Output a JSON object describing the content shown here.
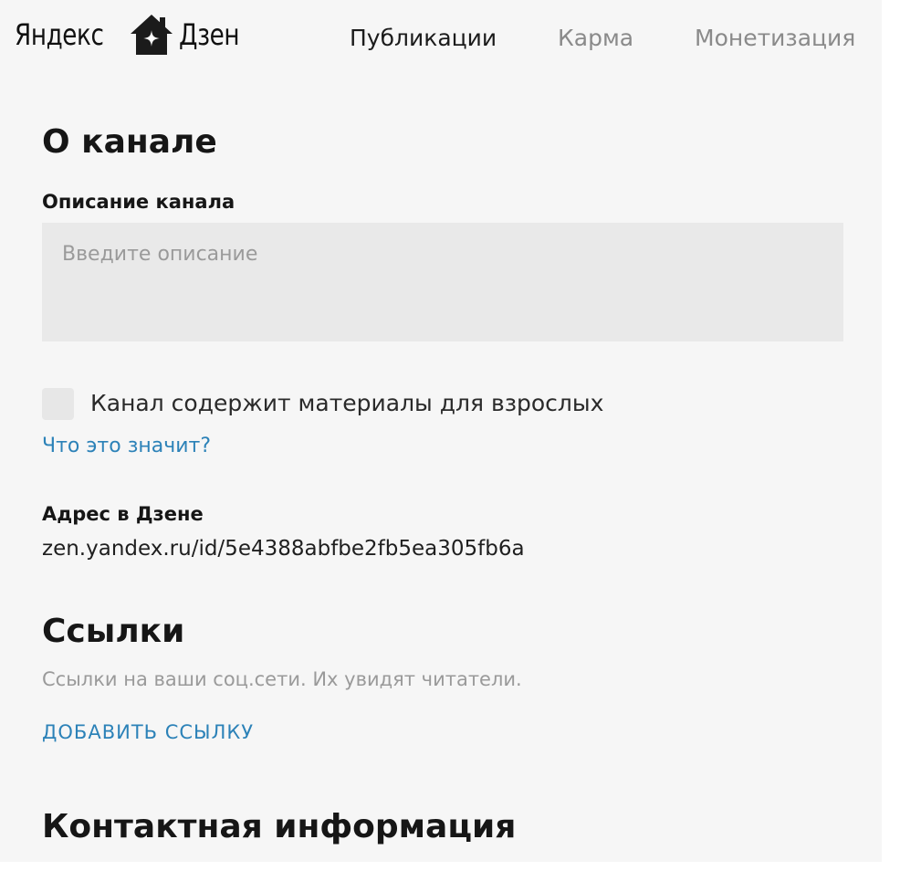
{
  "logo": {
    "word_left": "Яндекс",
    "word_right": "Дзен",
    "icon": "house-star-icon"
  },
  "nav": {
    "items": [
      {
        "label": "Публикации",
        "active": true
      },
      {
        "label": "Карма",
        "active": false
      },
      {
        "label": "Монетизация",
        "active": false
      }
    ]
  },
  "about": {
    "title": "О канале",
    "description_label": "Описание канала",
    "description_placeholder": "Введите описание",
    "description_value": "",
    "adult_checkbox_label": "Канал содержит материалы для взрослых",
    "adult_checked": false,
    "help_link": "Что это значит?",
    "address_label": "Адрес в Дзене",
    "address_value": "zen.yandex.ru/id/5e4388abfbe2fb5ea305fb6a"
  },
  "links": {
    "title": "Ссылки",
    "hint": "Ссылки на ваши соц.сети. Их увидят читатели.",
    "add_button": "ДОБАВИТЬ ССЫЛКУ"
  },
  "contacts": {
    "title": "Контактная информация"
  },
  "colors": {
    "background": "#f6f6f6",
    "input_background": "#e9e9e9",
    "link": "#2c82b8",
    "muted_text": "#9a9a9a",
    "nav_inactive": "#8a8a8a"
  }
}
